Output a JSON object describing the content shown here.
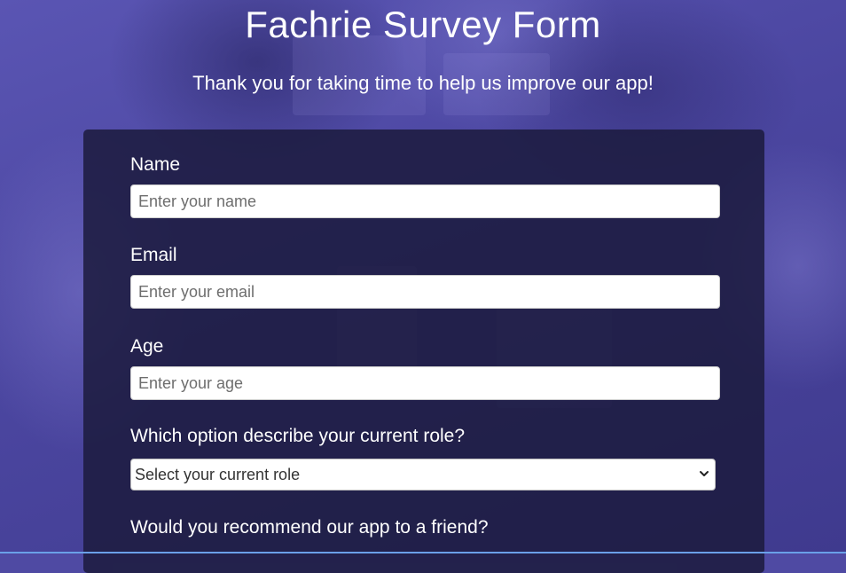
{
  "header": {
    "title": "Fachrie Survey Form",
    "subtitle": "Thank you for taking time to help us improve our app!"
  },
  "form": {
    "name": {
      "label": "Name",
      "placeholder": "Enter your name",
      "value": ""
    },
    "email": {
      "label": "Email",
      "placeholder": "Enter your email",
      "value": ""
    },
    "age": {
      "label": "Age",
      "placeholder": "Enter your age",
      "value": ""
    },
    "role": {
      "label": "Which option describe your current role?",
      "selected": "Select your current role"
    },
    "recommend": {
      "label": "Would you recommend our app to a friend?"
    }
  },
  "colors": {
    "background": "#4f4aa3",
    "card": "#1c1b3e",
    "text": "#ffffff"
  },
  "icons": {
    "select_arrow": "chevron-down-icon"
  }
}
